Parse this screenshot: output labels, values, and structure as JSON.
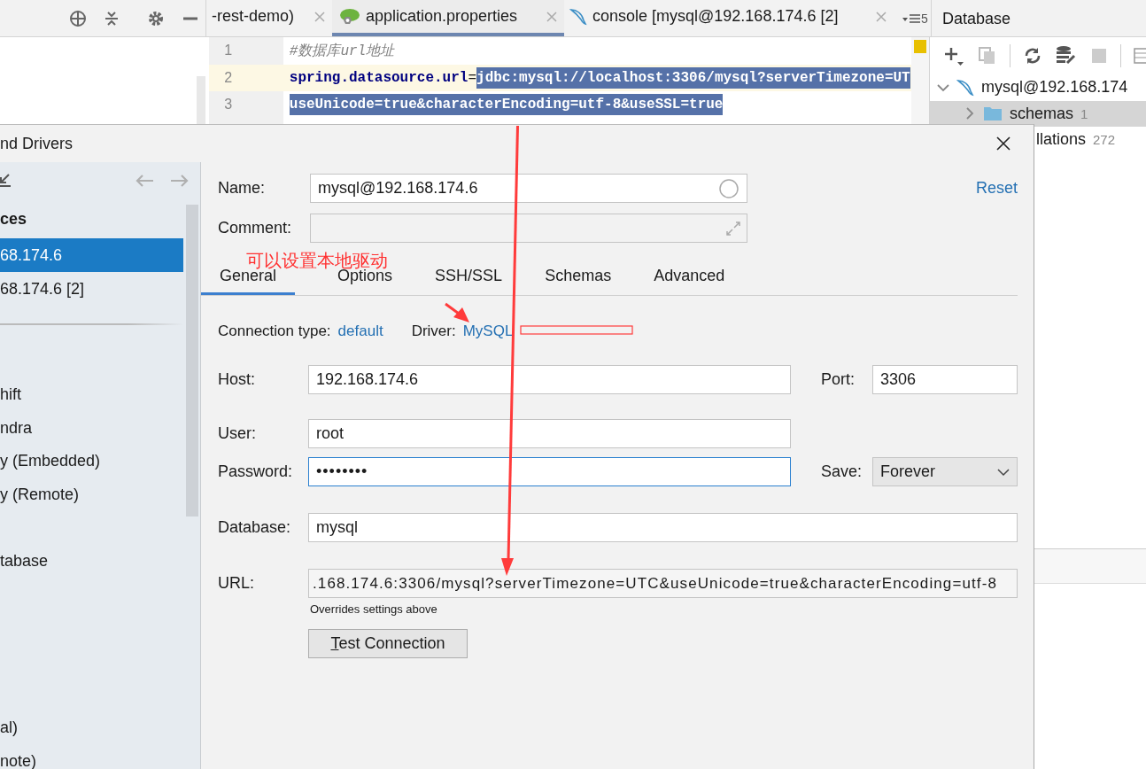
{
  "editor": {
    "tabs": [
      {
        "label": "-rest-demo)",
        "kind": "plain",
        "selected": false
      },
      {
        "label": "application.properties",
        "kind": "spring",
        "selected": true
      },
      {
        "label": "console [mysql@192.168.174.6 [2]",
        "kind": "mysql",
        "selected": false
      }
    ],
    "tab_count": "5",
    "lines": [
      {
        "number": "1",
        "kind": "comment",
        "text": "#数据库url地址",
        "current": false
      },
      {
        "number": "2",
        "kind": "property",
        "key": "spring.datasource.url",
        "op": "=",
        "text": "jdbc:mysql://localhost:3306/mysql?serverTimezone=UT",
        "current": true
      },
      {
        "number": "3",
        "kind": "continuation",
        "text": "useUnicode=true&characterEncoding=utf-8&useSSL=true",
        "current": false
      }
    ]
  },
  "database_panel": {
    "title": "Database",
    "tree": [
      {
        "label": "mysql@192.168.174",
        "expanded": true,
        "selected": false,
        "children": [
          {
            "label": "schemas",
            "count": "1",
            "kind": "folder",
            "expanded": false,
            "selected": true
          },
          {
            "label": "llations",
            "count": "272",
            "kind": "partial",
            "selected": false
          }
        ]
      }
    ]
  },
  "dialog": {
    "title": "nd Drivers",
    "sidebar": {
      "section": "ces",
      "sources": [
        {
          "label": "68.174.6",
          "selected": true
        },
        {
          "label": "68.174.6 [2]",
          "selected": false
        }
      ],
      "drivers": [
        {
          "label": "hift"
        },
        {
          "label": "ndra"
        },
        {
          "label": "y (Embedded)"
        },
        {
          "label": "y (Remote)"
        },
        {
          "label": "tabase"
        },
        {
          "label": "al)"
        },
        {
          "label": "note)"
        }
      ]
    },
    "name": {
      "label": "Name:",
      "value": "mysql@192.168.174.6"
    },
    "reset": "Reset",
    "comment": {
      "label": "Comment:"
    },
    "tabs": [
      {
        "label": "General",
        "selected": true
      },
      {
        "label": "Options",
        "selected": false
      },
      {
        "label": "SSH/SSL",
        "selected": false
      },
      {
        "label": "Schemas",
        "selected": false
      },
      {
        "label": "Advanced",
        "selected": false
      }
    ],
    "connection_type": {
      "label": "Connection type:",
      "value": "default"
    },
    "driver": {
      "label": "Driver:",
      "value": "MySQL"
    },
    "host": {
      "label": "Host:",
      "value": "192.168.174.6"
    },
    "port": {
      "label": "Port:",
      "value": "3306"
    },
    "user": {
      "label": "User:",
      "value": "root"
    },
    "password": {
      "label": "Password:",
      "value": "••••••••",
      "focused": true
    },
    "save": {
      "label": "Save:",
      "value": "Forever"
    },
    "database": {
      "label": "Database:",
      "value": "mysql"
    },
    "url": {
      "label": "URL:",
      "value": ".168.174.6:3306/mysql?serverTimezone=UTC&useUnicode=true&characterEncoding=utf-8"
    },
    "url_hint": "Overrides settings above",
    "test_button": "Test Connection"
  },
  "annotation": {
    "text": "可以设置本地驱动"
  }
}
